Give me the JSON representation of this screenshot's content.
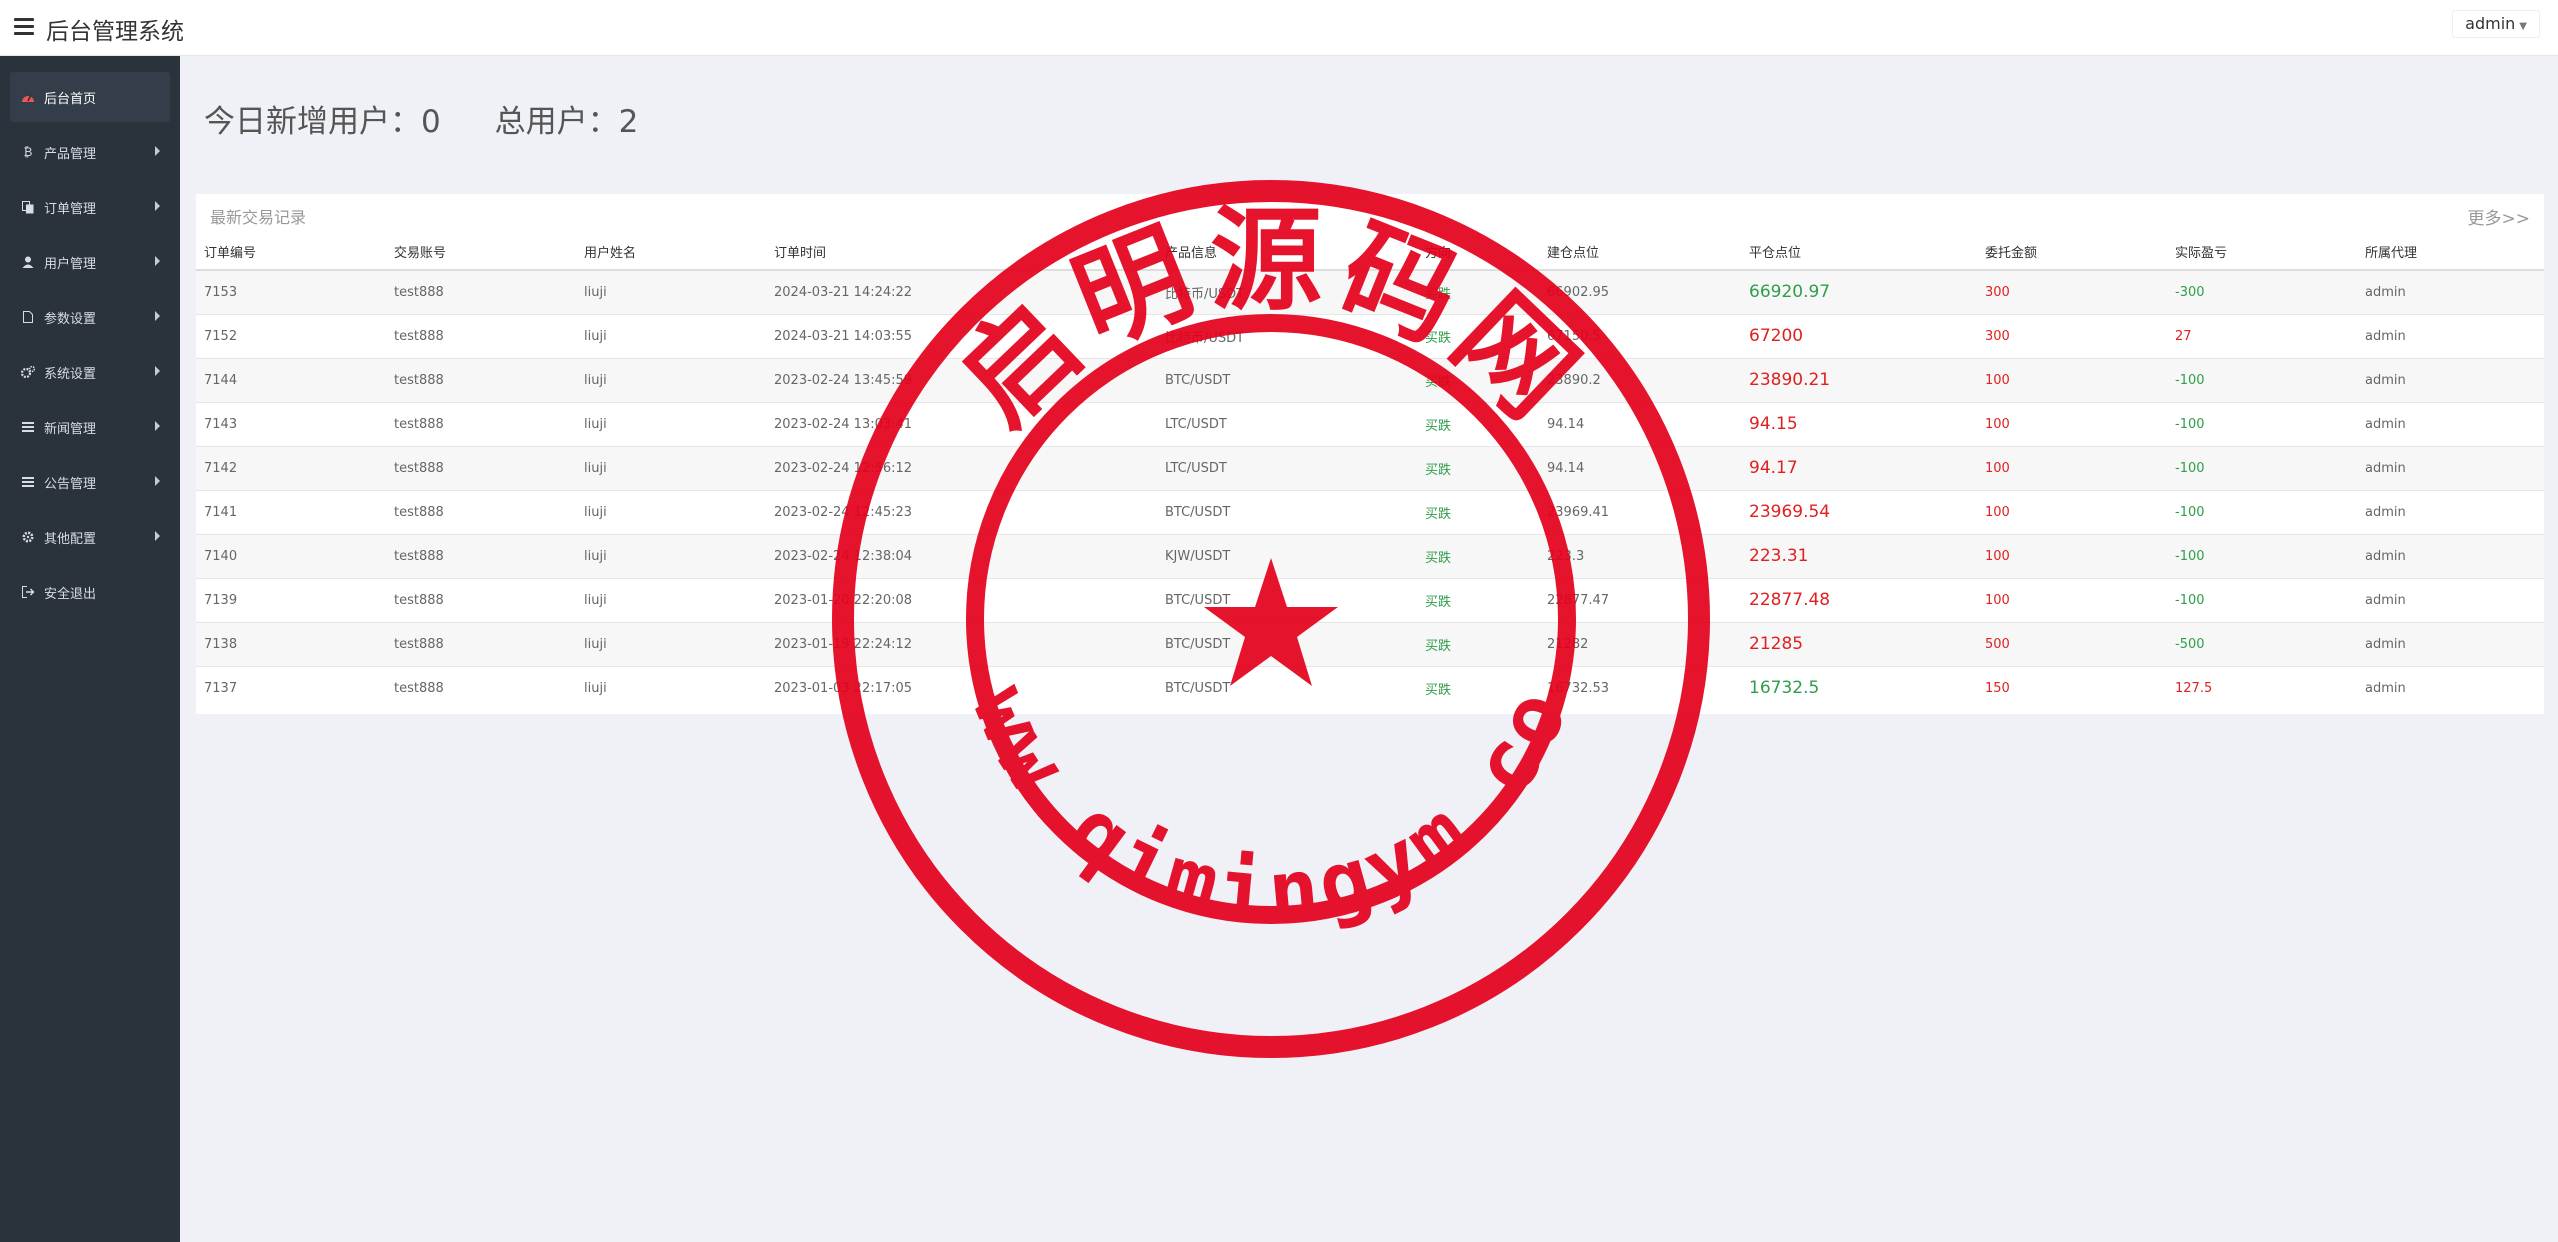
{
  "header": {
    "title": "后台管理系统",
    "user": "admin"
  },
  "sidebar": {
    "items": [
      {
        "label": "后台首页",
        "icon": "dashboard-icon",
        "active": true
      },
      {
        "label": "产品管理",
        "icon": "bitcoin-icon"
      },
      {
        "label": "订单管理",
        "icon": "copy-icon"
      },
      {
        "label": "用户管理",
        "icon": "user-icon"
      },
      {
        "label": "参数设置",
        "icon": "file-icon"
      },
      {
        "label": "系统设置",
        "icon": "gears-icon"
      },
      {
        "label": "新闻管理",
        "icon": "list-icon"
      },
      {
        "label": "公告管理",
        "icon": "list-icon"
      },
      {
        "label": "其他配置",
        "icon": "gear-icon"
      },
      {
        "label": "安全退出",
        "icon": "sign-out-icon"
      }
    ]
  },
  "stats": {
    "today_new_users": "今日新增用户：0",
    "total_users": "总用户：2"
  },
  "records": {
    "title": "最新交易记录",
    "more": "更多>>",
    "columns": [
      "订单编号",
      "交易账号",
      "用户姓名",
      "订单时间",
      "产品信息",
      "方向",
      "建仓点位",
      "平仓点位",
      "委托金额",
      "实际盈亏",
      "所属代理"
    ],
    "rows": [
      [
        "7153",
        "test888",
        "liuji",
        "2024-03-21 14:24:22",
        "比特币/USDT",
        "买跌",
        "66902.95",
        "66920.97",
        "300",
        "-300",
        "admin"
      ],
      [
        "7152",
        "test888",
        "liuji",
        "2024-03-21 14:03:55",
        "比特币/USDT",
        "买跌",
        "67150.5",
        "67200",
        "300",
        "27",
        "admin"
      ],
      [
        "7144",
        "test888",
        "liuji",
        "2023-02-24 13:45:59",
        "BTC/USDT",
        "买跌",
        "23890.2",
        "23890.21",
        "100",
        "-100",
        "admin"
      ],
      [
        "7143",
        "test888",
        "liuji",
        "2023-02-24 13:03:41",
        "LTC/USDT",
        "买跌",
        "94.14",
        "94.15",
        "100",
        "-100",
        "admin"
      ],
      [
        "7142",
        "test888",
        "liuji",
        "2023-02-24 12:56:12",
        "LTC/USDT",
        "买跌",
        "94.14",
        "94.17",
        "100",
        "-100",
        "admin"
      ],
      [
        "7141",
        "test888",
        "liuji",
        "2023-02-24 12:45:23",
        "BTC/USDT",
        "买跌",
        "23969.41",
        "23969.54",
        "100",
        "-100",
        "admin"
      ],
      [
        "7140",
        "test888",
        "liuji",
        "2023-02-24 12:38:04",
        "KJW/USDT",
        "买跌",
        "223.3",
        "223.31",
        "100",
        "-100",
        "admin"
      ],
      [
        "7139",
        "test888",
        "liuji",
        "2023-01-20 22:20:08",
        "BTC/USDT",
        "买跌",
        "22877.47",
        "22877.48",
        "100",
        "-100",
        "admin"
      ],
      [
        "7138",
        "test888",
        "liuji",
        "2023-01-19 22:24:12",
        "BTC/USDT",
        "买跌",
        "21282",
        "21285",
        "500",
        "-500",
        "admin"
      ],
      [
        "7137",
        "test888",
        "liuji",
        "2023-01-03 22:17:05",
        "BTC/USDT",
        "买跌",
        "16732.53",
        "16732.5",
        "150",
        "127.5",
        "admin"
      ]
    ],
    "close_colors": [
      "#2e9e4a",
      "#e02020",
      "#e02020",
      "#e02020",
      "#e02020",
      "#e02020",
      "#e02020",
      "#e02020",
      "#e02020",
      "#2e9e4a"
    ],
    "profit_colors": [
      "#2e9e4a",
      "#e02020",
      "#2e9e4a",
      "#2e9e4a",
      "#2e9e4a",
      "#2e9e4a",
      "#2e9e4a",
      "#2e9e4a",
      "#2e9e4a",
      "#e02020"
    ]
  },
  "watermark": {
    "top_text": "启明源码网",
    "bottom_text": "www.qimingym.com",
    "color": "#e4001b"
  }
}
